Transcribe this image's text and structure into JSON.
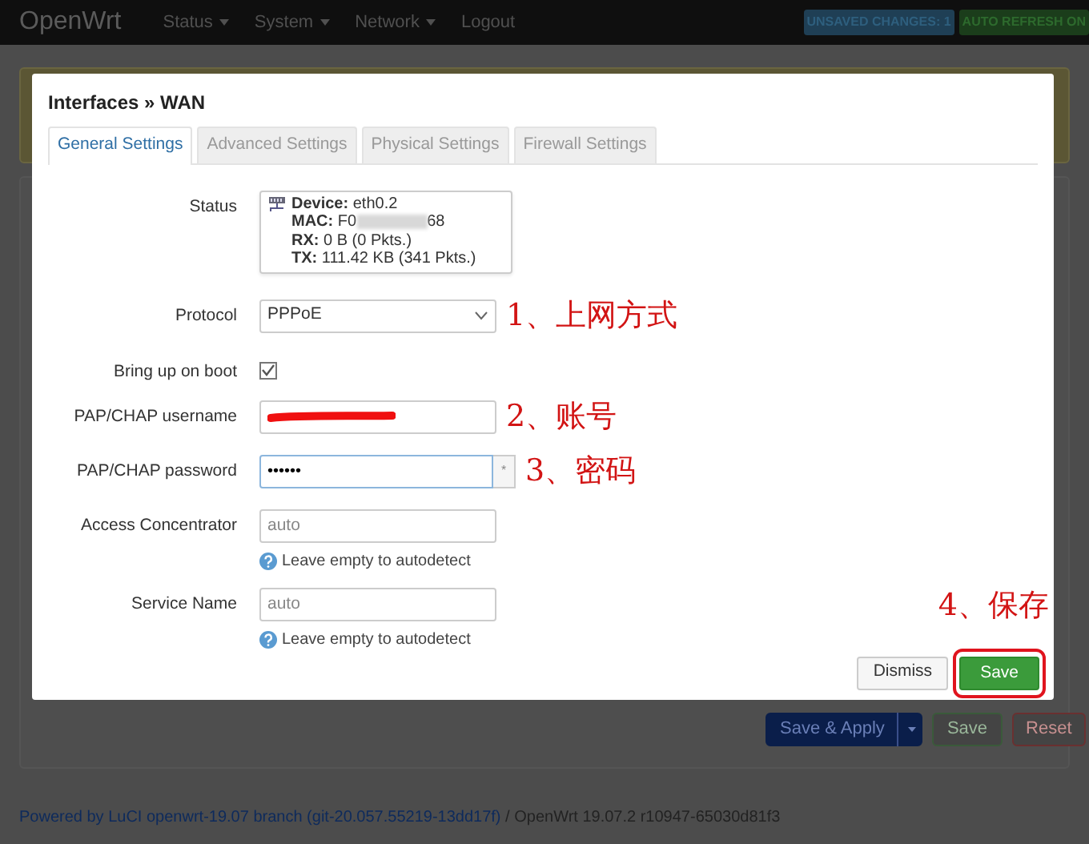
{
  "navbar": {
    "brand": "OpenWrt",
    "menu": [
      {
        "label": "Status",
        "dropdown": true
      },
      {
        "label": "System",
        "dropdown": true
      },
      {
        "label": "Network",
        "dropdown": true
      },
      {
        "label": "Logout",
        "dropdown": false
      }
    ],
    "badges": [
      {
        "text": "UNSAVED CHANGES: 1",
        "kind": "info"
      },
      {
        "text": "AUTO REFRESH ON",
        "kind": "success"
      }
    ]
  },
  "modal": {
    "title": "Interfaces » WAN",
    "tabs": [
      {
        "label": "General Settings",
        "selected": true
      },
      {
        "label": "Advanced Settings",
        "selected": false
      },
      {
        "label": "Physical Settings",
        "selected": false
      },
      {
        "label": "Firewall Settings",
        "selected": false
      }
    ],
    "status": {
      "label": "Status",
      "lines": [
        {
          "key": "Device:",
          "value": "eth0.2"
        },
        {
          "key": "MAC:",
          "value": "F0",
          "value_end": "68",
          "blurred": true
        },
        {
          "key": "RX:",
          "value": "0 B (0 Pkts.)"
        },
        {
          "key": "TX:",
          "value": "111.42 KB (341 Pkts.)"
        }
      ]
    },
    "fields": [
      {
        "kind": "select",
        "label": "Protocol",
        "value": "PPPoE",
        "annotation": "1、上网方式"
      },
      {
        "kind": "checkbox",
        "label": "Bring up on boot",
        "checked": true
      },
      {
        "kind": "redacted",
        "label": "PAP/CHAP username",
        "annotation": "2、账号"
      },
      {
        "kind": "password",
        "label": "PAP/CHAP password",
        "value": "••••••",
        "reveal": "*",
        "annotation": "3、密码"
      },
      {
        "kind": "text",
        "label": "Access Concentrator",
        "placeholder": "auto",
        "help": "Leave empty to autodetect"
      },
      {
        "kind": "text",
        "label": "Service Name",
        "placeholder": "auto",
        "help": "Leave empty to autodetect"
      }
    ],
    "buttons": [
      {
        "label": "Dismiss",
        "kind": "default"
      },
      {
        "label": "Save",
        "kind": "primary",
        "highlighted": true,
        "annotation": "4、保存"
      }
    ]
  },
  "page": {
    "buttons": [
      {
        "label": "Save & Apply",
        "kind": "apply"
      },
      {
        "label": "Save",
        "kind": "save"
      },
      {
        "label": "Reset",
        "kind": "reset"
      }
    ],
    "footer": {
      "link": "Powered by LuCI openwrt-19.07 branch (git-20.057.55219-13dd17f)",
      "text": "/ OpenWrt 19.07.2 r10947-65030d81f3"
    }
  }
}
